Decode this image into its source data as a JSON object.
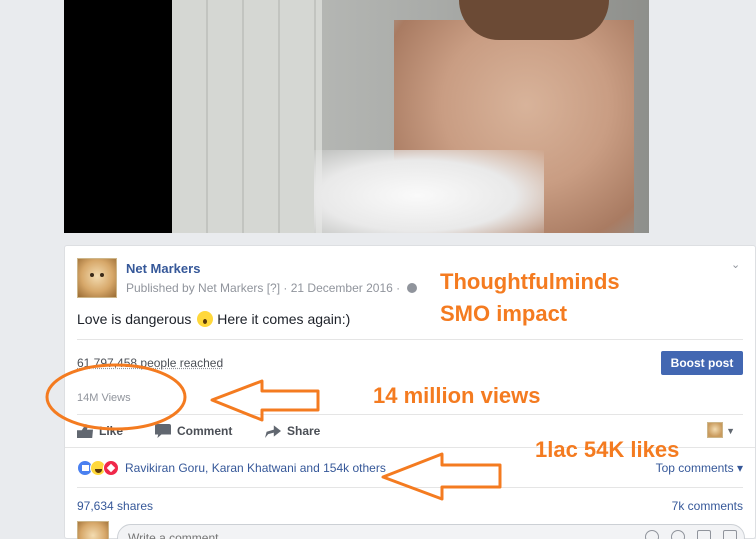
{
  "post": {
    "page_name": "Net Markers",
    "published_by": "Published by Net Markers [?] · 21 December 2016 ·",
    "text": "Love is dangerous",
    "text_tail": " Here it comes again:)",
    "reached": "61,797,458 people reached",
    "boost_label": "Boost post",
    "views": "14M Views"
  },
  "actions": {
    "like": "Like",
    "comment": "Comment",
    "share": "Share"
  },
  "reactions": {
    "names": "Ravikiran Goru, Karan Khatwani and 154k others",
    "top_comments": "Top comments ▾",
    "shares": "97,634 shares",
    "comments": "7k comments"
  },
  "comment_box": {
    "placeholder": "Write a comment..."
  },
  "annotations": {
    "title_line1": "Thoughtfulminds",
    "title_line2": "SMO impact",
    "views_note": "14 million views",
    "likes_note": "1lac 54K likes",
    "color": "#f47b20"
  },
  "icons": [
    "globe-icon",
    "chevron-down-icon",
    "like-icon",
    "comment-icon",
    "share-icon",
    "emoji-icon",
    "camera-icon",
    "gif-icon"
  ]
}
